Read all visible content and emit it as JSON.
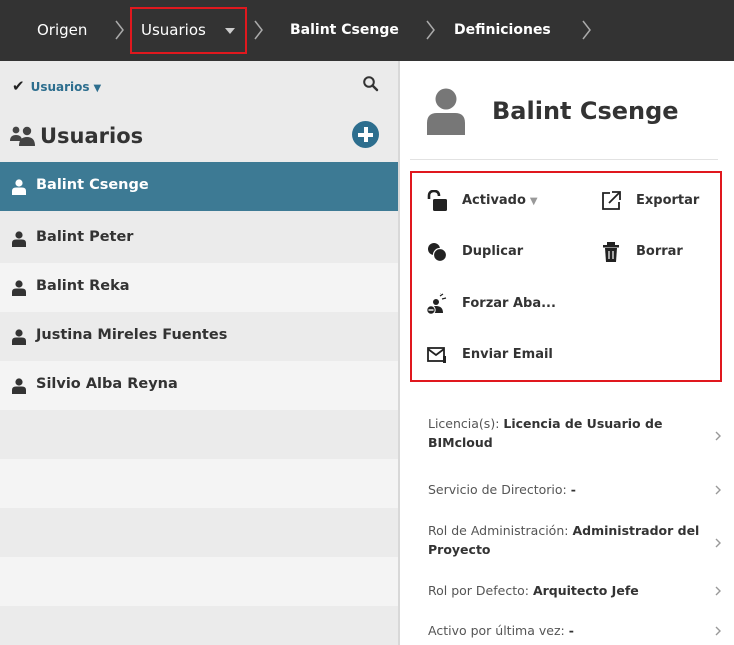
{
  "breadcrumb": {
    "items": [
      "Origen",
      "Usuarios",
      "Balint Csenge",
      "Definiciones"
    ]
  },
  "sidebar": {
    "filter_label": "Usuarios",
    "title": "Usuarios",
    "users": [
      {
        "name": "Balint Csenge",
        "selected": true
      },
      {
        "name": "Balint Peter",
        "selected": false
      },
      {
        "name": "Balint Reka",
        "selected": false
      },
      {
        "name": "Justina Mireles Fuentes",
        "selected": false
      },
      {
        "name": "Silvio Alba Reyna",
        "selected": false
      }
    ]
  },
  "detail": {
    "user_name": "Balint Csenge",
    "actions": {
      "activado": "Activado",
      "exportar": "Exportar",
      "duplicar": "Duplicar",
      "borrar": "Borrar",
      "forzar": "Forzar Aba...",
      "enviar_email": "Enviar Email"
    },
    "properties": [
      {
        "label": "Licencia(s):",
        "value": "Licencia de Usuario de BIMcloud"
      },
      {
        "label": "Servicio de Directorio:",
        "value": "-"
      },
      {
        "label": "Rol de Administración:",
        "value": "Administrador del Proyecto"
      },
      {
        "label": "Rol por Defecto:",
        "value": "Arquitecto Jefe"
      },
      {
        "label": "Activo por última vez:",
        "value": "-"
      }
    ]
  },
  "colors": {
    "accent": "#2d6e8e",
    "selected_row": "#3d7a94",
    "topbar": "#333333",
    "highlight": "#e0181e"
  }
}
